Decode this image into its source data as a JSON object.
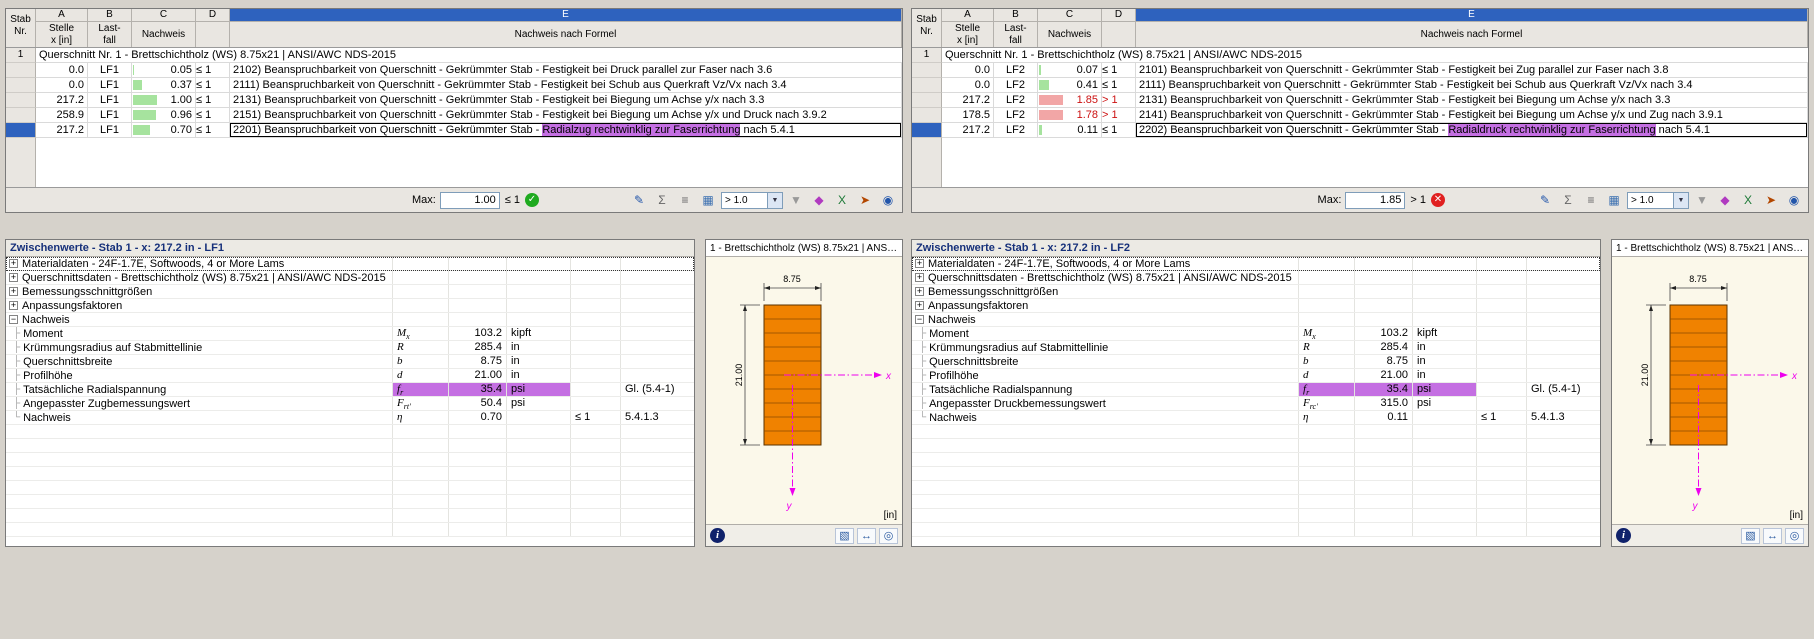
{
  "colors": {
    "accent_blue": "#2e62be",
    "green_bar": "#a6e39e",
    "red_bar": "#f2a6a6",
    "red_text": "#cc1111",
    "violet_highlight": "#c46fe2",
    "section_orange": "#f08200",
    "axis_magenta": "#ee00ee"
  },
  "icons": {
    "ok_glyph": "✓",
    "over_glyph": "✕",
    "dropdown_arrow": "▼",
    "expand_glyph": "+",
    "collapse_glyph": "−",
    "tree_branch": "├",
    "tree_end": "└"
  },
  "toolbar": {
    "filter_value": "> 1.0",
    "buttons_pre": [
      {
        "name": "edit-formula-icon",
        "glyph": "✎",
        "color": "#2255aa"
      },
      {
        "name": "sum-icon",
        "glyph": "Σ",
        "color": "#666666"
      },
      {
        "name": "list-details-icon",
        "glyph": "≡",
        "color": "#666666"
      },
      {
        "name": "result-diagram-icon",
        "glyph": "▦",
        "color": "#3a6fb0"
      }
    ],
    "buttons_post": [
      {
        "name": "filter-icon",
        "glyph": "▼",
        "color": "#999999"
      },
      {
        "name": "color-scale-icon",
        "glyph": "◆",
        "color": "#b03ac0"
      },
      {
        "name": "excel-export-icon",
        "glyph": "X",
        "color": "#1e7a38"
      },
      {
        "name": "export-icon",
        "glyph": "➤",
        "color": "#b34700"
      },
      {
        "name": "visibility-icon",
        "glyph": "◉",
        "color": "#2255aa"
      }
    ]
  },
  "panels": [
    {
      "table": {
        "corner_line1": "Stab",
        "corner_line2": "Nr.",
        "letters": [
          "A",
          "B",
          "C",
          "D",
          "E"
        ],
        "col_a": [
          "Stelle",
          "x [in]"
        ],
        "col_b": [
          "Last-",
          "fall"
        ],
        "col_c": "Nachweis",
        "col_e": "Nachweis nach Formel",
        "group_num": "1",
        "group_text": "Querschnitt Nr. 1 - Brettschichtholz (WS) 8.75x21 | ANSI/AWC NDS-2015",
        "rows": [
          {
            "x": "0.0",
            "lc": "LF1",
            "ratio": "0.05",
            "crit": "≤ 1",
            "status": "ok",
            "formula_pre": "2102) Beanspruchbarkeit von Querschnitt - Gekrümmter Stab - Festigkeit bei Druck parallel zur Faser nach 3.6",
            "formula_hl": "",
            "formula_post": ""
          },
          {
            "x": "0.0",
            "lc": "LF1",
            "ratio": "0.37",
            "crit": "≤ 1",
            "status": "ok",
            "formula_pre": "2111) Beanspruchbarkeit von Querschnitt - Gekrümmter Stab - Festigkeit bei Schub aus Querkraft Vz/Vx nach 3.4",
            "formula_hl": "",
            "formula_post": ""
          },
          {
            "x": "217.2",
            "lc": "LF1",
            "ratio": "1.00",
            "crit": "≤ 1",
            "status": "ok",
            "formula_pre": "2131) Beanspruchbarkeit von Querschnitt - Gekrümmter Stab - Festigkeit bei Biegung um Achse y/x nach 3.3",
            "formula_hl": "",
            "formula_post": ""
          },
          {
            "x": "258.9",
            "lc": "LF1",
            "ratio": "0.96",
            "crit": "≤ 1",
            "status": "ok",
            "formula_pre": "2151) Beanspruchbarkeit von Querschnitt - Gekrümmter Stab - Festigkeit bei Biegung um Achse y/x und Druck nach 3.9.2",
            "formula_hl": "",
            "formula_post": ""
          },
          {
            "x": "217.2",
            "lc": "LF1",
            "ratio": "0.70",
            "crit": "≤ 1",
            "status": "ok",
            "selected": true,
            "formula_pre": "2201) Beanspruchbarkeit von Querschnitt - Gekrümmter Stab - ",
            "formula_hl": "Radialzug rechtwinklig zur Faserrichtung",
            "formula_post": " nach 5.4.1"
          }
        ],
        "max_label": "Max:",
        "max_value": "1.00",
        "max_crit": "≤ 1",
        "max_status": "ok"
      },
      "zw": {
        "title": "Zwischenwerte - Stab 1 - x: 217.2 in - LF1",
        "tree": [
          {
            "type": "collapsed",
            "label": "Materialdaten - 24F-1.7E, Softwoods, 4 or More Lams",
            "focus": true
          },
          {
            "type": "collapsed",
            "label": "Querschnittsdaten - Brettschichtholz (WS) 8.75x21 | ANSI/AWC NDS-2015"
          },
          {
            "type": "collapsed",
            "label": "Bemessungsschnittgrößen"
          },
          {
            "type": "collapsed",
            "label": "Anpassungsfaktoren"
          },
          {
            "type": "expanded",
            "label": "Nachweis"
          },
          {
            "type": "item",
            "label": "Moment",
            "sym": "M",
            "sub": "x",
            "value": "103.2",
            "unit": "kipft"
          },
          {
            "type": "item",
            "label": "Krümmungsradius auf Stabmittellinie",
            "sym": "R",
            "value": "285.4",
            "unit": "in"
          },
          {
            "type": "item",
            "label": "Querschnittsbreite",
            "sym": "b",
            "value": "8.75",
            "unit": "in"
          },
          {
            "type": "item",
            "label": "Profilhöhe",
            "sym": "d",
            "value": "21.00",
            "unit": "in"
          },
          {
            "type": "item",
            "label": "Tatsächliche Radialspannung",
            "sym": "f",
            "sub": "r",
            "value": "35.4",
            "unit": "psi",
            "highlight": true,
            "ref": "Gl. (5.4-1)"
          },
          {
            "type": "item",
            "label": "Angepasster Zugbemessungswert",
            "sym": "F",
            "sub": "rt'",
            "value": "50.4",
            "unit": "psi"
          },
          {
            "type": "item",
            "label": "Nachweis",
            "sym": "η",
            "value": "0.70",
            "crit": "≤ 1",
            "ref": "5.4.1.3"
          }
        ]
      },
      "section": {
        "title": "1 - Brettschichtholz (WS) 8.75x21 | ANSI...",
        "width_dim": "8.75",
        "height_dim": "21.00",
        "unit_label": "[in]",
        "axis_x": "x",
        "axis_y": "y",
        "info_glyph": "i",
        "icon1": "▧",
        "icon2": "↔",
        "icon3": "◎"
      }
    },
    {
      "table": {
        "corner_line1": "Stab",
        "corner_line2": "Nr.",
        "letters": [
          "A",
          "B",
          "C",
          "D",
          "E"
        ],
        "col_a": [
          "Stelle",
          "x [in]"
        ],
        "col_b": [
          "Last-",
          "fall"
        ],
        "col_c": "Nachweis",
        "col_e": "Nachweis nach Formel",
        "group_num": "1",
        "group_text": "Querschnitt Nr. 1 - Brettschichtholz (WS) 8.75x21 | ANSI/AWC NDS-2015",
        "rows": [
          {
            "x": "0.0",
            "lc": "LF2",
            "ratio": "0.07",
            "crit": "≤ 1",
            "status": "ok",
            "formula_pre": "2101) Beanspruchbarkeit von Querschnitt - Gekrümmter Stab - Festigkeit bei Zug parallel zur Faser nach 3.8",
            "formula_hl": "",
            "formula_post": ""
          },
          {
            "x": "0.0",
            "lc": "LF2",
            "ratio": "0.41",
            "crit": "≤ 1",
            "status": "ok",
            "formula_pre": "2111) Beanspruchbarkeit von Querschnitt - Gekrümmter Stab - Festigkeit bei Schub aus Querkraft Vz/Vx nach 3.4",
            "formula_hl": "",
            "formula_post": ""
          },
          {
            "x": "217.2",
            "lc": "LF2",
            "ratio": "1.85",
            "crit": "> 1",
            "status": "over",
            "formula_pre": "2131) Beanspruchbarkeit von Querschnitt - Gekrümmter Stab - Festigkeit bei Biegung um Achse y/x nach 3.3",
            "formula_hl": "",
            "formula_post": ""
          },
          {
            "x": "178.5",
            "lc": "LF2",
            "ratio": "1.78",
            "crit": "> 1",
            "status": "over",
            "formula_pre": "2141) Beanspruchbarkeit von Querschnitt - Gekrümmter Stab - Festigkeit bei Biegung um Achse y/x und Zug nach 3.9.1",
            "formula_hl": "",
            "formula_post": ""
          },
          {
            "x": "217.2",
            "lc": "LF2",
            "ratio": "0.11",
            "crit": "≤ 1",
            "status": "ok",
            "selected": true,
            "formula_pre": "2202) Beanspruchbarkeit von Querschnitt - Gekrümmter Stab - ",
            "formula_hl": "Radialdruck rechtwinklig zur Faserrichtung",
            "formula_post": " nach 5.4.1"
          }
        ],
        "max_label": "Max:",
        "max_value": "1.85",
        "max_crit": "> 1",
        "max_status": "over"
      },
      "zw": {
        "title": "Zwischenwerte - Stab 1 - x: 217.2 in - LF2",
        "tree": [
          {
            "type": "collapsed",
            "label": "Materialdaten - 24F-1.7E, Softwoods, 4 or More Lams",
            "focus": true
          },
          {
            "type": "collapsed",
            "label": "Querschnittsdaten - Brettschichtholz (WS) 8.75x21 | ANSI/AWC NDS-2015"
          },
          {
            "type": "collapsed",
            "label": "Bemessungsschnittgrößen"
          },
          {
            "type": "collapsed",
            "label": "Anpassungsfaktoren"
          },
          {
            "type": "expanded",
            "label": "Nachweis"
          },
          {
            "type": "item",
            "label": "Moment",
            "sym": "M",
            "sub": "x",
            "value": "103.2",
            "unit": "kipft"
          },
          {
            "type": "item",
            "label": "Krümmungsradius auf Stabmittellinie",
            "sym": "R",
            "value": "285.4",
            "unit": "in"
          },
          {
            "type": "item",
            "label": "Querschnittsbreite",
            "sym": "b",
            "value": "8.75",
            "unit": "in"
          },
          {
            "type": "item",
            "label": "Profilhöhe",
            "sym": "d",
            "value": "21.00",
            "unit": "in"
          },
          {
            "type": "item",
            "label": "Tatsächliche Radialspannung",
            "sym": "f",
            "sub": "r",
            "value": "35.4",
            "unit": "psi",
            "highlight": true,
            "ref": "Gl. (5.4-1)"
          },
          {
            "type": "item",
            "label": "Angepasster Druckbemessungswert",
            "sym": "F",
            "sub": "rc'",
            "value": "315.0",
            "unit": "psi"
          },
          {
            "type": "item",
            "label": "Nachweis",
            "sym": "η",
            "value": "0.11",
            "crit": "≤ 1",
            "ref": "5.4.1.3"
          }
        ]
      },
      "section": {
        "title": "1 - Brettschichtholz (WS) 8.75x21 | ANSI...",
        "width_dim": "8.75",
        "height_dim": "21.00",
        "unit_label": "[in]",
        "axis_x": "x",
        "axis_y": "y",
        "info_glyph": "i",
        "icon1": "▧",
        "icon2": "↔",
        "icon3": "◎"
      }
    }
  ]
}
